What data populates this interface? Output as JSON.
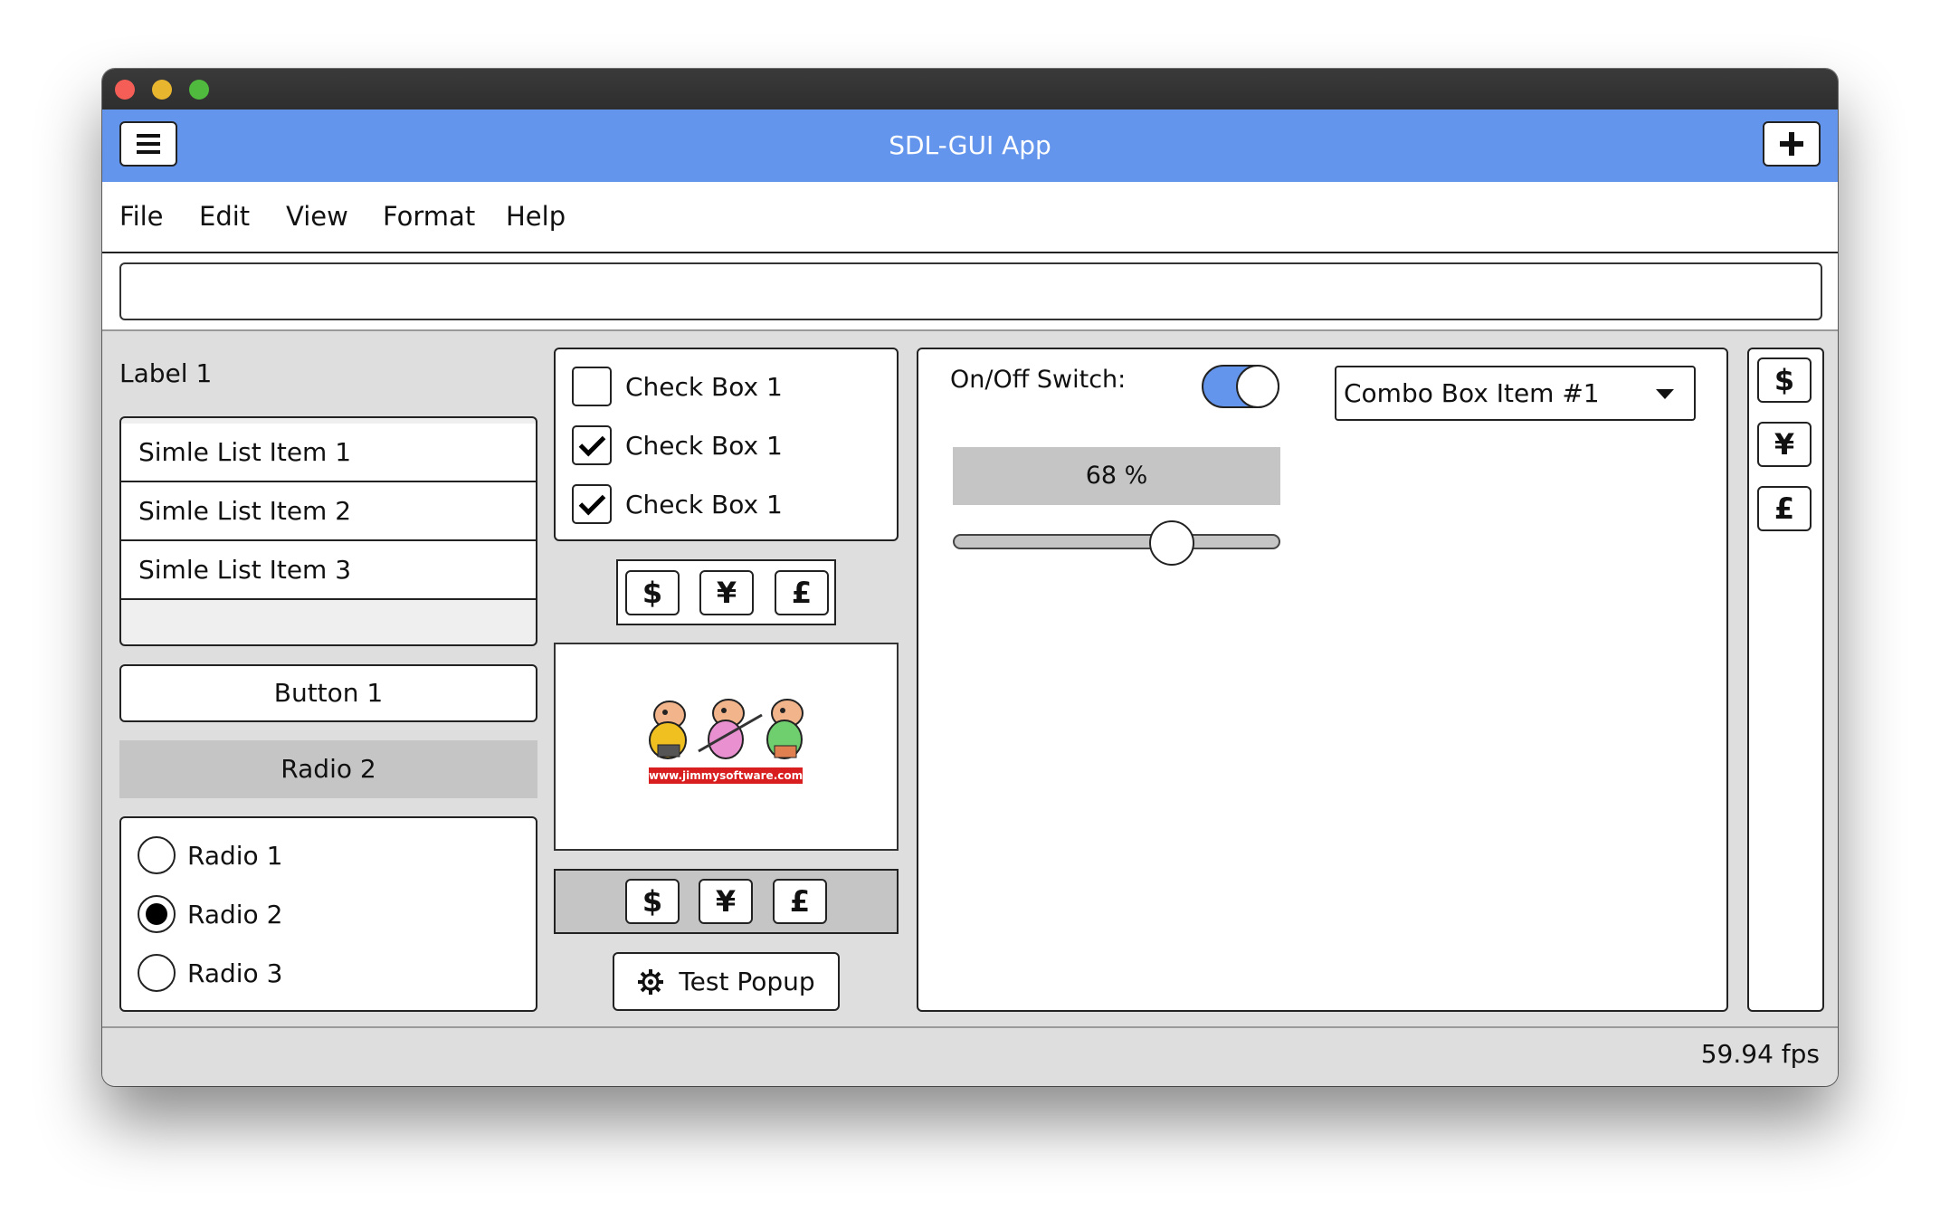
{
  "window": {
    "title": "SDL-GUI App",
    "accent_color": "#6495ed"
  },
  "header": {
    "menu_icon": "hamburger-icon",
    "add_icon": "plus-icon"
  },
  "menubar": {
    "items": [
      "File",
      "Edit",
      "View",
      "Format",
      "Help"
    ]
  },
  "text_input": {
    "value": "",
    "placeholder": ""
  },
  "left": {
    "label": "Label 1",
    "list_items": [
      "Simle List Item 1",
      "Simle List Item 2",
      "Simle List Item 3"
    ],
    "button": "Button 1",
    "radio_display": "Radio 2",
    "radios": [
      {
        "label": "Radio 1",
        "checked": false
      },
      {
        "label": "Radio 2",
        "checked": true
      },
      {
        "label": "Radio 3",
        "checked": false
      }
    ]
  },
  "middle": {
    "checkboxes": [
      {
        "label": "Check Box 1",
        "checked": false
      },
      {
        "label": "Check Box 1",
        "checked": true
      },
      {
        "label": "Check Box 1",
        "checked": true
      }
    ],
    "currency_buttons": [
      "$",
      "¥",
      "£"
    ],
    "image_caption": "www.jimmysoftware.com",
    "popup_button": "Test Popup",
    "popup_icon": "gear-icon"
  },
  "right": {
    "switch_label": "On/Off Switch:",
    "switch_on": true,
    "combo_value": "Combo Box Item #1",
    "progress_text": "68 %",
    "progress_value": 68,
    "slider_value": 0.67,
    "side_buttons": [
      "$",
      "¥",
      "£"
    ]
  },
  "status": {
    "fps": "59.94 fps"
  }
}
